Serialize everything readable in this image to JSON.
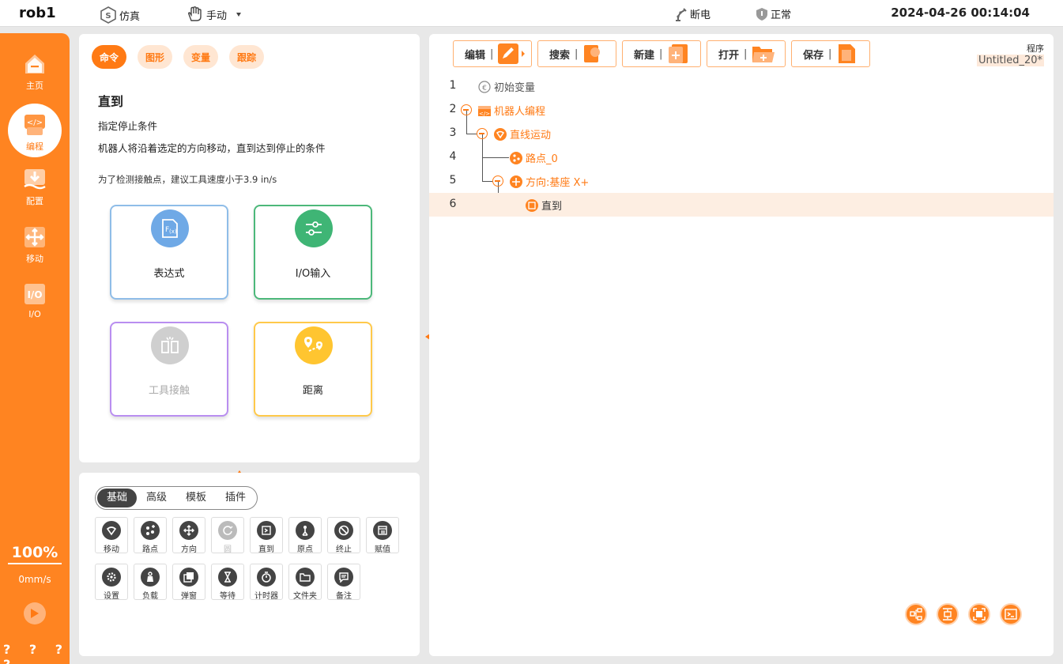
{
  "topbar": {
    "robot_name": "rob1",
    "mode_sim": "仿真",
    "mode_manual": "手动",
    "power_status": "断电",
    "safety_status": "正常",
    "datetime": "2024-04-26 00:14:04"
  },
  "sidebar": {
    "items": [
      {
        "label": "主页",
        "icon": "home-icon"
      },
      {
        "label": "编程",
        "icon": "code-icon"
      },
      {
        "label": "配置",
        "icon": "config-icon"
      },
      {
        "label": "移动",
        "icon": "move-icon"
      },
      {
        "label": "I/O",
        "icon": "io-icon"
      }
    ],
    "speed_percent": "100%",
    "speed_value": "0mm/s",
    "bottom_text": "? ? ? ?"
  },
  "command_panel": {
    "tabs": [
      "命令",
      "图形",
      "变量",
      "跟踪"
    ],
    "title": "直到",
    "subtitle": "指定停止条件",
    "description": "机器人将沿着选定的方向移动，直到达到停止的条件",
    "note": "为了检测接触点，建议工具速度小于3.9 in/s",
    "cards": [
      {
        "label": "表达式",
        "icon": "expression-icon",
        "color": "#7fb3e8"
      },
      {
        "label": "I/O输入",
        "icon": "io-input-icon",
        "color": "#4cb87a"
      },
      {
        "label": "工具接触",
        "icon": "tool-contact-icon",
        "color": "#b98ef0"
      },
      {
        "label": "距离",
        "icon": "distance-icon",
        "color": "#ffc94a"
      }
    ]
  },
  "toolbox": {
    "tabs": [
      "基础",
      "高级",
      "模板",
      "插件"
    ],
    "row1": [
      "移动",
      "路点",
      "方向",
      "圆",
      "直到",
      "原点",
      "终止",
      "赋值"
    ],
    "row2": [
      "设置",
      "负载",
      "弹窗",
      "等待",
      "计时器",
      "文件夹",
      "备注"
    ]
  },
  "program": {
    "toolbar": [
      "编辑",
      "搜索",
      "新建",
      "打开",
      "保存"
    ],
    "label": "程序",
    "name": "Untitled_20*",
    "lines": [
      {
        "num": "1",
        "text": "初始变量"
      },
      {
        "num": "2",
        "text": "机器人编程"
      },
      {
        "num": "3",
        "text": "直线运动"
      },
      {
        "num": "4",
        "text": "路点_0"
      },
      {
        "num": "5",
        "text": "方向:基座 X+"
      },
      {
        "num": "6",
        "text": "直到"
      }
    ]
  },
  "colors": {
    "accent": "#ff8421",
    "accent_dark": "#ff7a14"
  }
}
